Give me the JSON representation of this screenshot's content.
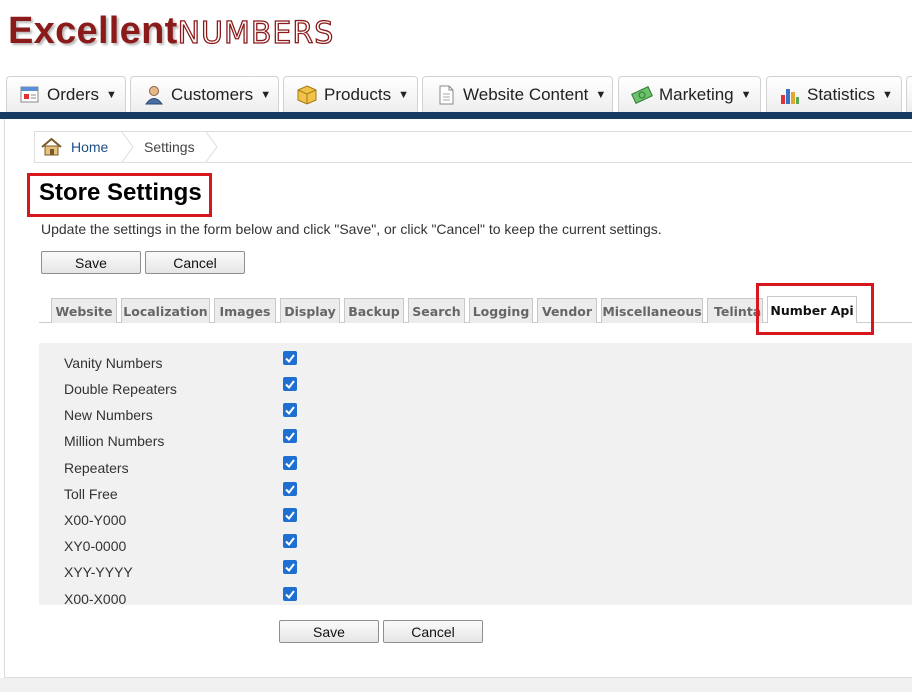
{
  "brand": {
    "name_part1": "Excellent",
    "name_part2": "Numbers",
    "color": "#8b1a1a"
  },
  "nav": [
    {
      "label": "Orders",
      "icon": "orders-icon"
    },
    {
      "label": "Customers",
      "icon": "customer-icon"
    },
    {
      "label": "Products",
      "icon": "box-icon"
    },
    {
      "label": "Website Content",
      "icon": "document-icon"
    },
    {
      "label": "Marketing",
      "icon": "money-icon"
    },
    {
      "label": "Statistics",
      "icon": "bar-chart-icon"
    }
  ],
  "breadcrumb": {
    "home": "Home",
    "current": "Settings"
  },
  "page": {
    "title": "Store Settings",
    "intro": "Update the settings in the form below and click \"Save\", or click \"Cancel\" to keep the current settings.",
    "save_label": "Save",
    "cancel_label": "Cancel"
  },
  "tabs": [
    {
      "label": "Website",
      "active": false
    },
    {
      "label": "Localization",
      "active": false
    },
    {
      "label": "Images",
      "active": false
    },
    {
      "label": "Display",
      "active": false
    },
    {
      "label": "Backup",
      "active": false
    },
    {
      "label": "Search",
      "active": false
    },
    {
      "label": "Logging",
      "active": false
    },
    {
      "label": "Vendor",
      "active": false
    },
    {
      "label": "Miscellaneous",
      "active": false
    },
    {
      "label": "Telinta",
      "active": false
    },
    {
      "label": "Number Api",
      "active": true
    }
  ],
  "options": [
    {
      "label": "Vanity Numbers",
      "checked": true
    },
    {
      "label": "Double Repeaters",
      "checked": true
    },
    {
      "label": "New Numbers",
      "checked": true
    },
    {
      "label": "Million Numbers",
      "checked": true
    },
    {
      "label": "Repeaters",
      "checked": true
    },
    {
      "label": "Toll Free",
      "checked": true
    },
    {
      "label": "X00-Y000",
      "checked": true
    },
    {
      "label": "XY0-0000",
      "checked": true
    },
    {
      "label": "XYY-YYYY",
      "checked": true
    },
    {
      "label": "X00-X000",
      "checked": true
    }
  ],
  "colors": {
    "highlight": "#d6181e",
    "nav_stripe": "#173a63",
    "checkbox": "#1f6fd1",
    "link": "#1e4f86"
  }
}
